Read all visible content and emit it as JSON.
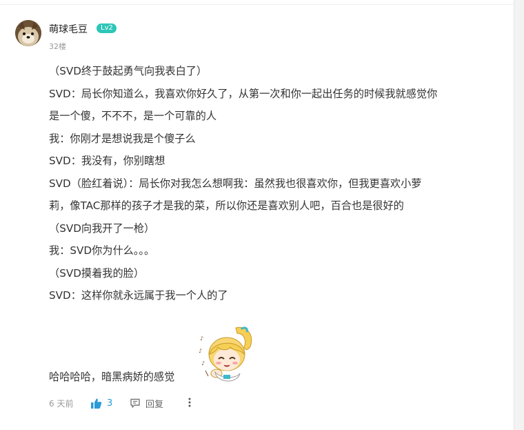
{
  "comment": {
    "user": {
      "name": "萌球毛豆",
      "level": "Lv2"
    },
    "floor": "32楼",
    "lines": [
      "（SVD终于鼓起勇气向我表白了）",
      "SVD：局长你知道么，我喜欢你好久了，从第一次和你一起出任务的时候我就感觉你",
      "是一个傻，不不不，是一个可靠的人",
      "我：你刚才是想说我是个傻子么",
      "SVD：我没有，你别瞎想",
      "SVD（脸红着说）：局长你对我怎么想啊我：虽然我也很喜欢你，但我更喜欢小萝",
      "莉，像TAC那样的孩子才是我的菜，所以你还是喜欢别人吧，百合也是很好的",
      "（SVD向我开了一枪）",
      "我：SVD你为什么。。。",
      "（SVD摸着我的脸）",
      "SVD：这样你就永远属于我一个人的了"
    ],
    "last_line": "哈哈哈哈，暗黑病娇的感觉",
    "sticker": "chibi-girl-sticker",
    "footer": {
      "time": "6 天前",
      "likes": "3",
      "reply_label": "回复"
    }
  },
  "colors": {
    "level_badge": "#2ec6b8",
    "like_accent": "#2c9ad6",
    "meta_text": "#999999"
  },
  "icons": [
    "thumbs-up-icon",
    "comment-icon",
    "more-vertical-icon"
  ]
}
